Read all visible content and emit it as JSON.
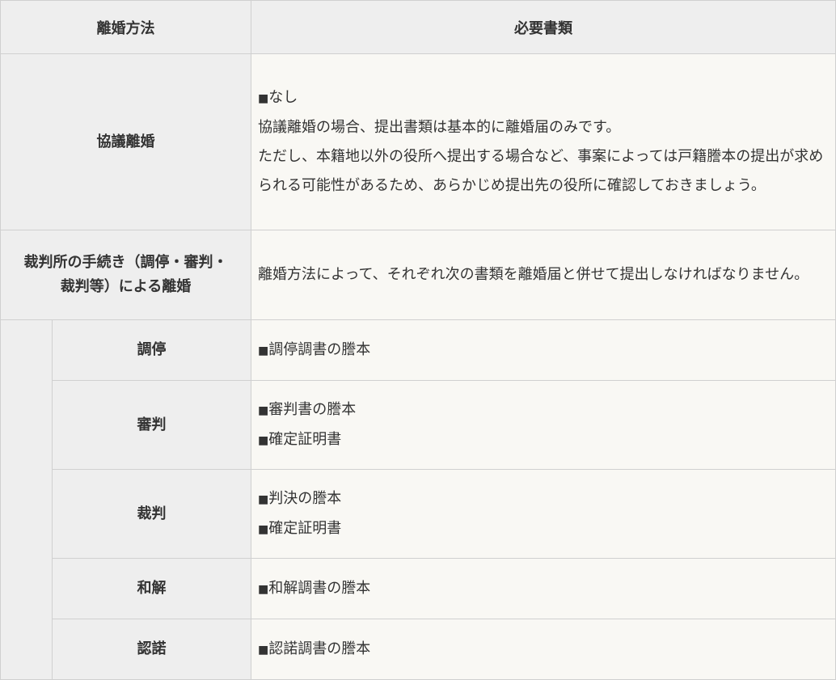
{
  "header": {
    "col1": "離婚方法",
    "col2": "必要書類"
  },
  "kyogi": {
    "label": "協議離婚",
    "bullet": "■",
    "item": "なし",
    "line1": "協議離婚の場合、提出書類は基本的に離婚届のみです。",
    "line2": "ただし、本籍地以外の役所へ提出する場合など、事案によっては戸籍謄本の提出が求められる可能性があるため、あらかじめ提出先の役所に確認しておきましょう。"
  },
  "court": {
    "label_line1": "裁判所の手続き（調停・審判・",
    "label_line2": "裁判等）による離婚",
    "desc": "離婚方法によって、それぞれ次の書類を離婚届と併せて提出しなければなりません。",
    "rows": [
      {
        "label": "調停",
        "items": [
          "調停調書の謄本"
        ]
      },
      {
        "label": "審判",
        "items": [
          "審判書の謄本",
          "確定証明書"
        ]
      },
      {
        "label": "裁判",
        "items": [
          "判決の謄本",
          "確定証明書"
        ]
      },
      {
        "label": "和解",
        "items": [
          "和解調書の謄本"
        ]
      },
      {
        "label": "認諾",
        "items": [
          "認諾調書の謄本"
        ]
      }
    ]
  },
  "bullet": "■",
  "colors": {
    "header_bg": "#eeeeee",
    "body_bg": "#f9f8f4",
    "border": "#d0d0d0"
  }
}
